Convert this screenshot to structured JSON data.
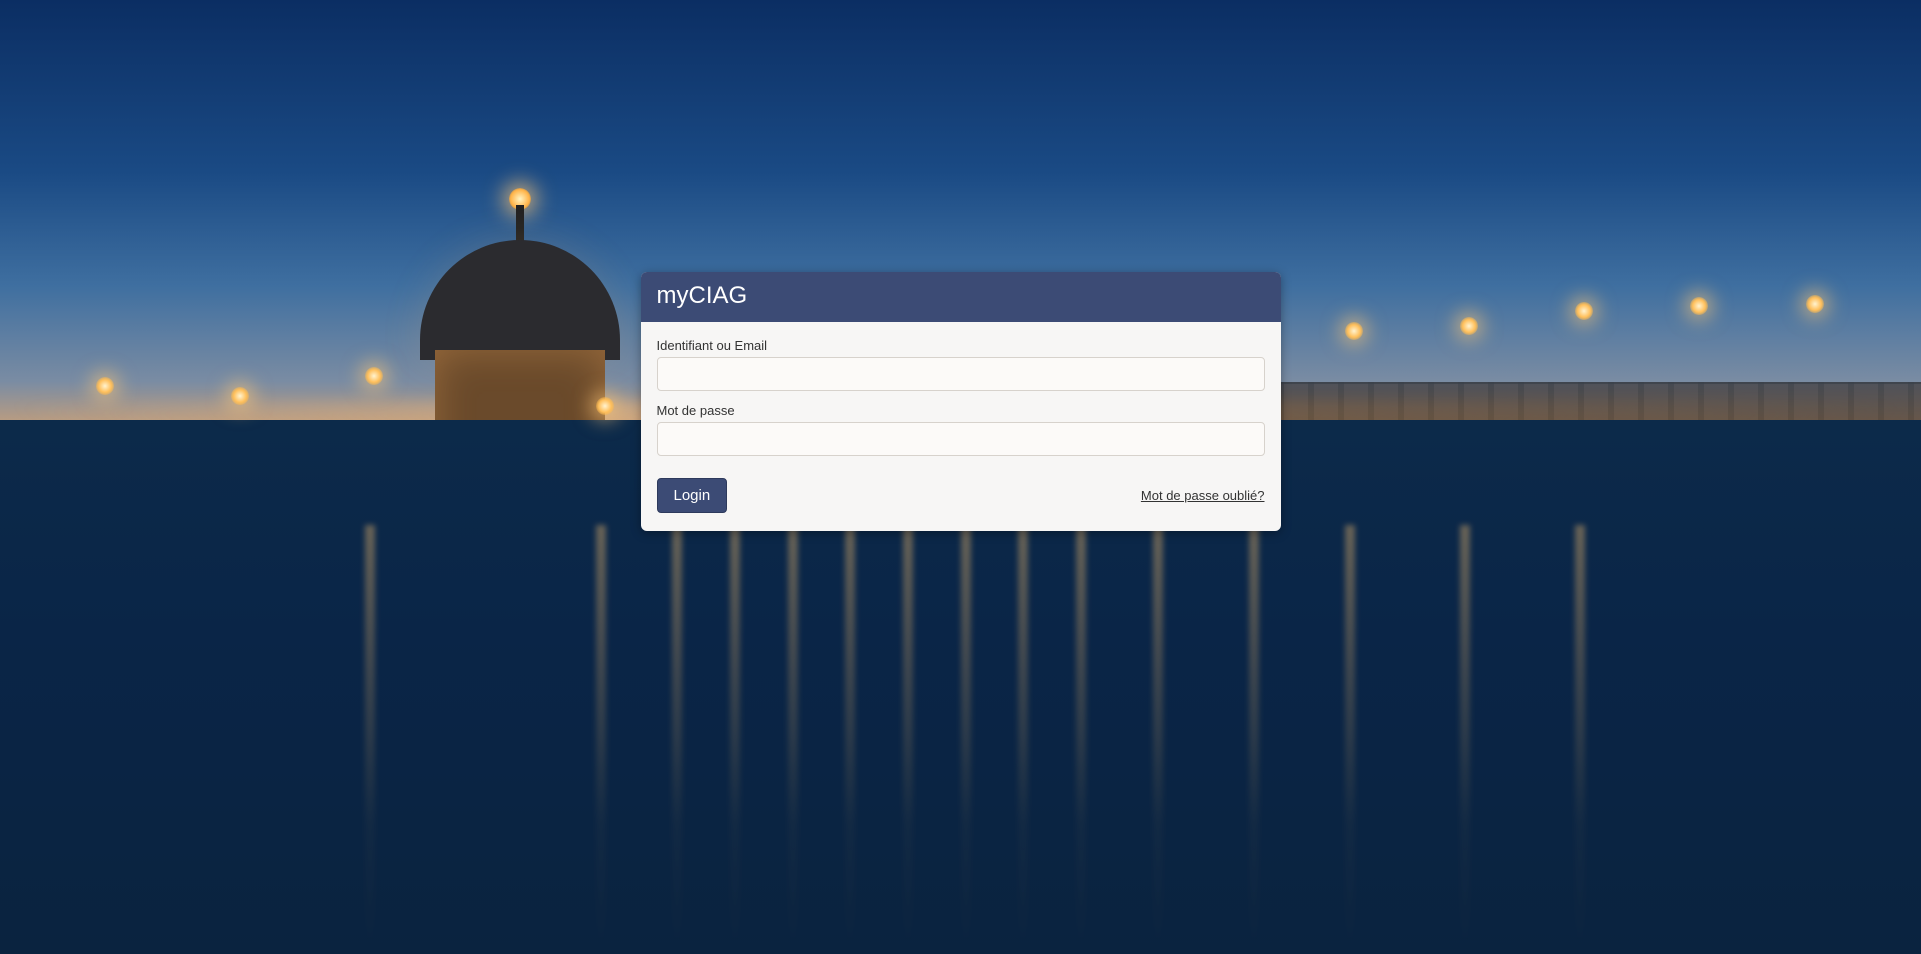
{
  "page": {
    "title": "myCIAG"
  },
  "form": {
    "username_label": "Identifiant ou Email",
    "username_value": "",
    "password_label": "Mot de passe",
    "password_value": "",
    "login_button": "Login",
    "forgot_link": "Mot de passe oublié?"
  },
  "colors": {
    "panel_header": "#3c4b75",
    "panel_bg": "#f7f6f5",
    "button_bg": "#3c4b75"
  }
}
